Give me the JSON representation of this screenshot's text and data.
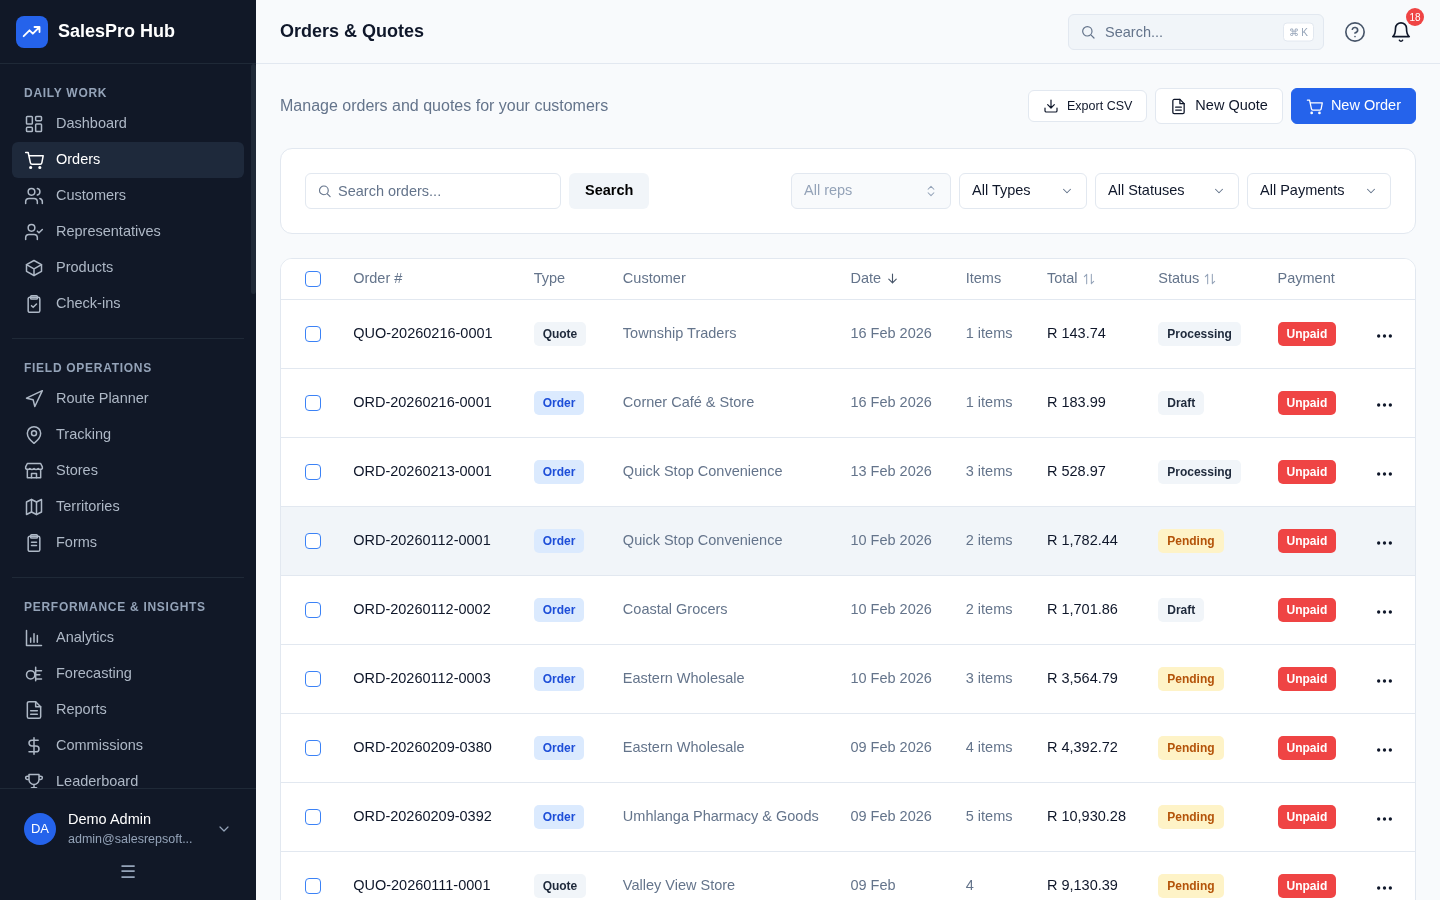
{
  "brand": {
    "name": "SalesPro Hub"
  },
  "sidebar": {
    "sections": [
      {
        "title": "DAILY WORK",
        "items": [
          {
            "label": "Dashboard",
            "selected": false
          },
          {
            "label": "Orders",
            "selected": true
          },
          {
            "label": "Customers",
            "selected": false
          },
          {
            "label": "Representatives",
            "selected": false
          },
          {
            "label": "Products",
            "selected": false
          },
          {
            "label": "Check-ins",
            "selected": false
          }
        ]
      },
      {
        "title": "FIELD OPERATIONS",
        "items": [
          {
            "label": "Route Planner",
            "selected": false
          },
          {
            "label": "Tracking",
            "selected": false
          },
          {
            "label": "Stores",
            "selected": false
          },
          {
            "label": "Territories",
            "selected": false
          },
          {
            "label": "Forms",
            "selected": false
          }
        ]
      },
      {
        "title": "PERFORMANCE & INSIGHTS",
        "items": [
          {
            "label": "Analytics",
            "selected": false
          },
          {
            "label": "Forecasting",
            "selected": false
          },
          {
            "label": "Reports",
            "selected": false
          },
          {
            "label": "Commissions",
            "selected": false
          },
          {
            "label": "Leaderboard",
            "selected": false
          }
        ]
      }
    ],
    "user": {
      "initials": "DA",
      "name": "Demo Admin",
      "email": "admin@salesrepsoft..."
    },
    "collapse_glyph": "☰"
  },
  "topbar": {
    "title": "Orders & Quotes",
    "search": {
      "placeholder": "Search...",
      "shortcut": "⌘ K"
    },
    "notifications": "18"
  },
  "page": {
    "subtitle": "Manage orders and quotes for your customers",
    "buttons": [
      {
        "label": "Export CSV",
        "kind": "export"
      },
      {
        "label": "New Quote",
        "kind": "quote"
      },
      {
        "label": "New Order",
        "kind": "primary"
      }
    ]
  },
  "filters": {
    "search": {
      "placeholder": "Search orders..."
    },
    "search_button": "Search",
    "selects": [
      {
        "value": "All reps",
        "kind": "updown",
        "disabled": true
      },
      {
        "value": "All Types",
        "kind": "down",
        "disabled": false
      },
      {
        "value": "All Statuses",
        "kind": "down",
        "disabled": false
      },
      {
        "value": "All Payments",
        "kind": "down",
        "disabled": false
      }
    ]
  },
  "table": {
    "all_checked": false,
    "columns": [
      {
        "label": "Order #",
        "kind": "plain"
      },
      {
        "label": "Type",
        "kind": "plain"
      },
      {
        "label": "Customer",
        "kind": "plain"
      },
      {
        "label": "Date",
        "kind": "sorted"
      },
      {
        "label": "Items",
        "kind": "plain"
      },
      {
        "label": "Total",
        "kind": "sortable"
      },
      {
        "label": "Status",
        "kind": "sortable"
      },
      {
        "label": "Payment",
        "kind": "plain"
      }
    ],
    "rows": [
      {
        "checked": false,
        "highlighted": false,
        "number": "QUO-20260216-0001",
        "type": {
          "label": "Quote",
          "color": "#f1f5f9"
        },
        "customer": "Township Traders",
        "date": "16 Feb 2026",
        "items": "1 items",
        "total": "R 143.74",
        "status": {
          "label": "Processing",
          "color": "#f1f5f9"
        },
        "payment": {
          "label": "Unpaid",
          "color": "#ef4444"
        }
      },
      {
        "checked": false,
        "highlighted": false,
        "number": "ORD-20260216-0001",
        "type": {
          "label": "Order",
          "color": "#dbeafe"
        },
        "customer": "Corner Café & Store",
        "date": "16 Feb 2026",
        "items": "1 items",
        "total": "R 183.99",
        "status": {
          "label": "Draft",
          "color": "#f1f5f9"
        },
        "payment": {
          "label": "Unpaid",
          "color": "#ef4444"
        }
      },
      {
        "checked": false,
        "highlighted": false,
        "number": "ORD-20260213-0001",
        "type": {
          "label": "Order",
          "color": "#dbeafe"
        },
        "customer": "Quick Stop Convenience",
        "date": "13 Feb 2026",
        "items": "3 items",
        "total": "R 528.97",
        "status": {
          "label": "Processing",
          "color": "#f1f5f9"
        },
        "payment": {
          "label": "Unpaid",
          "color": "#ef4444"
        }
      },
      {
        "checked": false,
        "highlighted": true,
        "number": "ORD-20260112-0001",
        "type": {
          "label": "Order",
          "color": "#dbeafe"
        },
        "customer": "Quick Stop Convenience",
        "date": "10 Feb 2026",
        "items": "2 items",
        "total": "R 1,782.44",
        "status": {
          "label": "Pending",
          "color": "#fef3c7"
        },
        "payment": {
          "label": "Unpaid",
          "color": "#ef4444"
        }
      },
      {
        "checked": false,
        "highlighted": false,
        "number": "ORD-20260112-0002",
        "type": {
          "label": "Order",
          "color": "#dbeafe"
        },
        "customer": "Coastal Grocers",
        "date": "10 Feb 2026",
        "items": "2 items",
        "total": "R 1,701.86",
        "status": {
          "label": "Draft",
          "color": "#f1f5f9"
        },
        "payment": {
          "label": "Unpaid",
          "color": "#ef4444"
        }
      },
      {
        "checked": false,
        "highlighted": false,
        "number": "ORD-20260112-0003",
        "type": {
          "label": "Order",
          "color": "#dbeafe"
        },
        "customer": "Eastern Wholesale",
        "date": "10 Feb 2026",
        "items": "3 items",
        "total": "R 3,564.79",
        "status": {
          "label": "Pending",
          "color": "#fef3c7"
        },
        "payment": {
          "label": "Unpaid",
          "color": "#ef4444"
        }
      },
      {
        "checked": false,
        "highlighted": false,
        "number": "ORD-20260209-0380",
        "type": {
          "label": "Order",
          "color": "#dbeafe"
        },
        "customer": "Eastern Wholesale",
        "date": "09 Feb 2026",
        "items": "4 items",
        "total": "R 4,392.72",
        "status": {
          "label": "Pending",
          "color": "#fef3c7"
        },
        "payment": {
          "label": "Unpaid",
          "color": "#ef4444"
        }
      },
      {
        "checked": false,
        "highlighted": false,
        "number": "ORD-20260209-0392",
        "type": {
          "label": "Order",
          "color": "#dbeafe"
        },
        "customer": "Umhlanga Pharmacy & Goods",
        "date": "09 Feb 2026",
        "items": "5 items",
        "total": "R 10,930.28",
        "status": {
          "label": "Pending",
          "color": "#fef3c7"
        },
        "payment": {
          "label": "Unpaid",
          "color": "#ef4444"
        }
      },
      {
        "checked": false,
        "highlighted": false,
        "number": "QUO-20260111-0001",
        "type": {
          "label": "Quote",
          "color": "#f1f5f9"
        },
        "customer": "Valley View Store",
        "date": "09 Feb",
        "items": "4",
        "total": "R 9,130.39",
        "status": {
          "label": "Pending",
          "color": "#fef3c7"
        },
        "payment": {
          "label": "Unpaid",
          "color": "#ef4444"
        }
      }
    ]
  }
}
